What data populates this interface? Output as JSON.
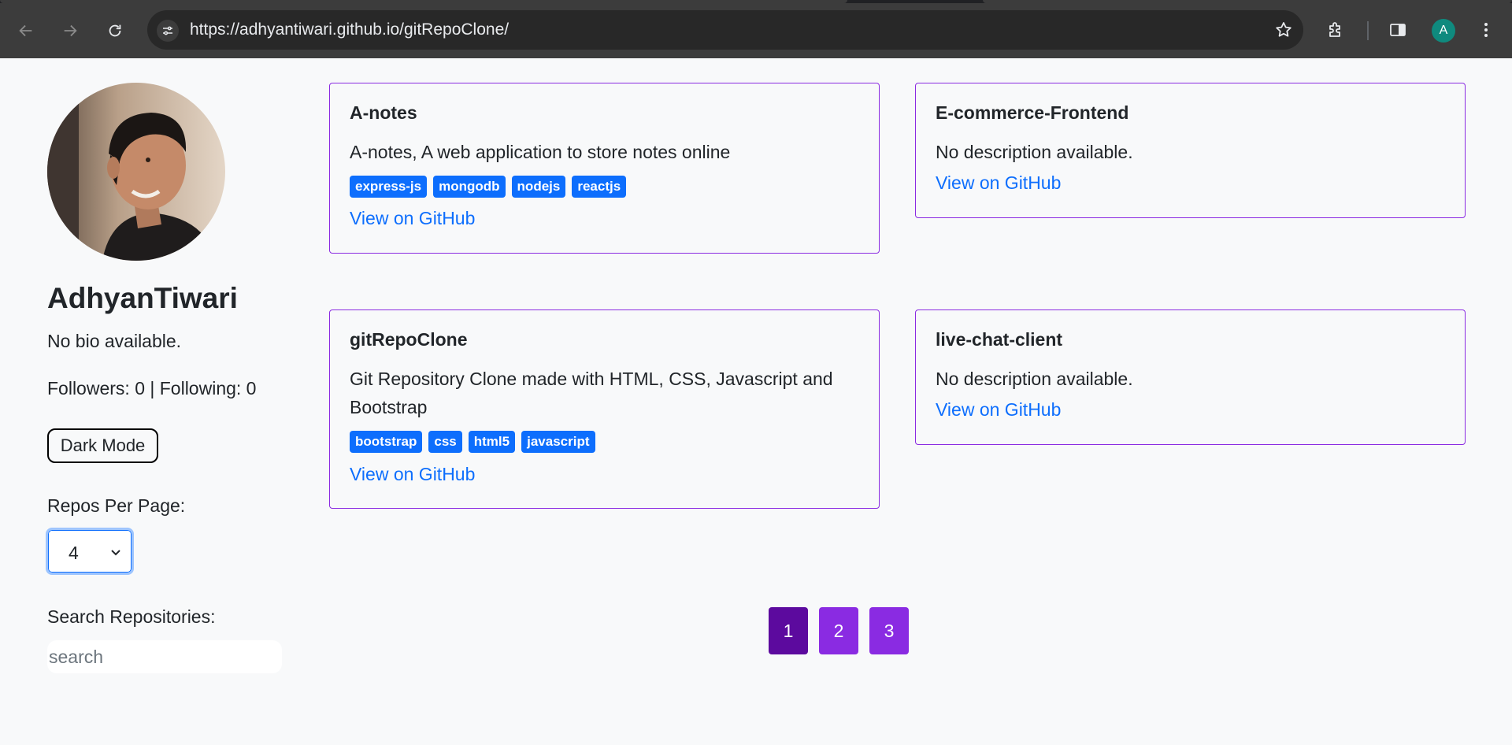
{
  "browser": {
    "url": "https://adhyantiwari.github.io/gitRepoClone/",
    "profile_initial": "A"
  },
  "profile": {
    "username": "AdhyanTiwari",
    "bio": "No bio available.",
    "followers_text": "Followers: 0",
    "separator": " | ",
    "following_text": "Following: 0"
  },
  "controls": {
    "dark_mode_label": "Dark Mode",
    "per_page_label": "Repos Per Page:",
    "per_page_value": "4",
    "search_label": "Search Repositories:",
    "search_placeholder": "search"
  },
  "repos": [
    {
      "name": "A-notes",
      "description": "A-notes, A web application to store notes online",
      "topics": [
        "express-js",
        "mongodb",
        "nodejs",
        "reactjs"
      ],
      "link": "View on GitHub"
    },
    {
      "name": "E-commerce-Frontend",
      "description": "No description available.",
      "topics": [],
      "link": "View on GitHub"
    },
    {
      "name": "gitRepoClone",
      "description": "Git Repository Clone made with HTML, CSS, Javascript and Bootstrap",
      "topics": [
        "bootstrap",
        "css",
        "html5",
        "javascript"
      ],
      "link": "View on GitHub"
    },
    {
      "name": "live-chat-client",
      "description": "No description available.",
      "topics": [],
      "link": "View on GitHub"
    }
  ],
  "pagination": {
    "pages": [
      "1",
      "2",
      "3"
    ],
    "current": "1"
  },
  "colors": {
    "card_border": "#8a2be2",
    "topic_bg": "#0d6efd",
    "link": "#0d6efd",
    "page_btn": "#8a2be2",
    "page_btn_active": "#5c0a9e"
  }
}
